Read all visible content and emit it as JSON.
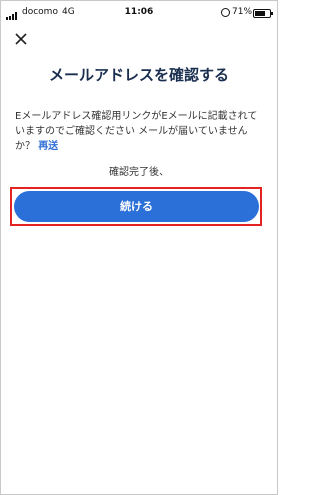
{
  "status_bar": {
    "carrier": "docomo",
    "network": "4G",
    "time": "11:06",
    "battery": "71%"
  },
  "icons": {
    "close": "close-icon",
    "signal": "signal-icon",
    "lock": "orientation-lock-icon",
    "battery": "battery-icon"
  },
  "page": {
    "title": "メールアドレスを確認する",
    "message": "Eメールアドレス確認用リンクがEメールに記載されていますのでご確認ください メールが届いていませんか？",
    "resend_link": "再送",
    "after_confirm": "確認完了後、",
    "continue_label": "続ける"
  },
  "colors": {
    "accent": "#2b6fd8",
    "title": "#1a2f4f",
    "highlight": "#e52222"
  }
}
